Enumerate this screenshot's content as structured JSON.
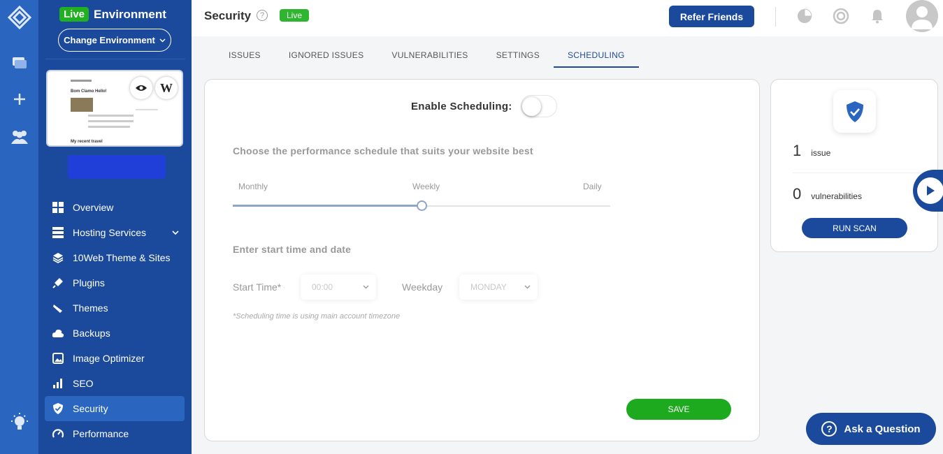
{
  "rail": {
    "icons": [
      "logo-icon",
      "windows-icon",
      "plus-icon",
      "team-icon",
      "lightbulb-icon"
    ]
  },
  "sidebar": {
    "live_badge": "Live",
    "env_title": "Environment",
    "change_env": "Change Environment",
    "site_preview": {
      "heading": "Bom Clamo Hello!",
      "footer": "My recent travel"
    },
    "items": [
      {
        "label": "Overview",
        "icon": "grid-icon"
      },
      {
        "label": "Hosting Services",
        "icon": "server-icon"
      },
      {
        "label": "10Web Theme & Sites",
        "icon": "layers-icon"
      },
      {
        "label": "Plugins",
        "icon": "plug-icon"
      },
      {
        "label": "Themes",
        "icon": "brush-icon"
      },
      {
        "label": "Backups",
        "icon": "cloud-upload-icon"
      },
      {
        "label": "Image Optimizer",
        "icon": "image-icon"
      },
      {
        "label": "SEO",
        "icon": "bar-chart-icon"
      },
      {
        "label": "Security",
        "icon": "shield-icon",
        "active": true
      },
      {
        "label": "Performance",
        "icon": "gauge-icon"
      }
    ]
  },
  "header": {
    "title": "Security",
    "live": "Live",
    "refer": "Refer Friends"
  },
  "tabs": [
    {
      "label": "ISSUES"
    },
    {
      "label": "IGNORED ISSUES"
    },
    {
      "label": "VULNERABILITIES"
    },
    {
      "label": "SETTINGS"
    },
    {
      "label": "SCHEDULING",
      "active": true
    }
  ],
  "scheduling": {
    "enable_label": "Enable Scheduling:",
    "enabled": false,
    "choose_heading": "Choose the performance schedule that suits your website best",
    "slider_labels": [
      "Monthly",
      "Weekly",
      "Daily"
    ],
    "slider_value": "Weekly",
    "start_heading": "Enter start time and date",
    "start_time_label": "Start Time*",
    "start_time_value": "00:00",
    "weekday_label": "Weekday",
    "weekday_value": "MONDAY",
    "note": "*Scheduling time is using main account timezone",
    "save": "SAVE"
  },
  "summary": {
    "issues_count": "1",
    "issues_label": "issue",
    "vuln_count": "0",
    "vuln_label": "vulnerabilities",
    "run_scan": "RUN SCAN"
  },
  "help": {
    "ask": "Ask a Question"
  },
  "colors": {
    "primary": "#1b4a9c",
    "green": "#21b021",
    "rail": "#2a66bf"
  }
}
